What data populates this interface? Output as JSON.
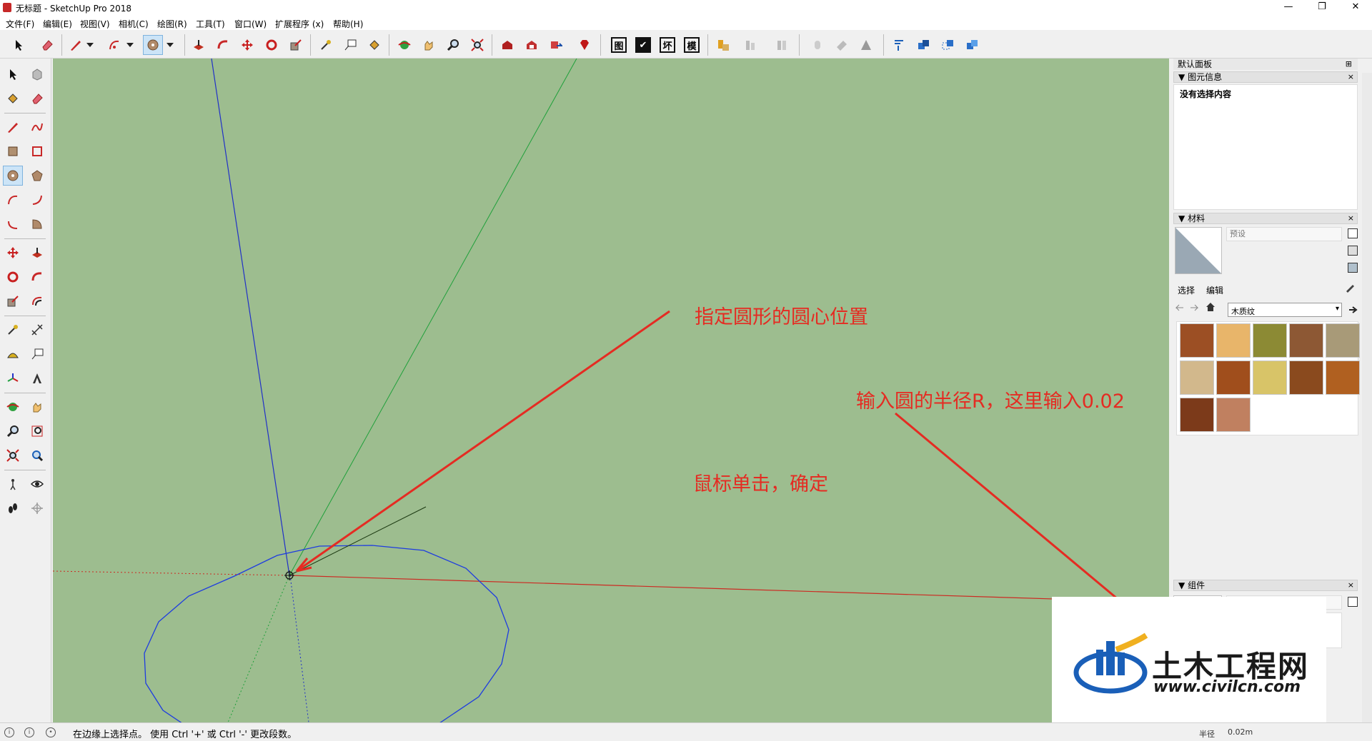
{
  "window": {
    "title": "无标题 - SketchUp Pro 2018",
    "minimize": "—",
    "maximize": "❐",
    "close": "✕"
  },
  "menu": {
    "items": [
      "文件(F)",
      "编辑(E)",
      "视图(V)",
      "相机(C)",
      "绘图(R)",
      "工具(T)",
      "窗口(W)",
      "扩展程序 (x)",
      "帮助(H)"
    ]
  },
  "toolbar": {
    "view_buttons": [
      "图",
      "✔",
      "坏",
      "模"
    ],
    "selected_tool": "circle-tool"
  },
  "annotations": {
    "center_note": "指定圆形的圆心位置",
    "radius_note": "输入圆的半径R，这里输入0.02",
    "click_note": "鼠标单击，确定"
  },
  "panel": {
    "title": "默认面板",
    "pin": "⊞",
    "entity_info": {
      "header": "图元信息",
      "empty_text": "没有选择内容"
    },
    "materials": {
      "header": "材料",
      "name_placeholder": "预设",
      "tab_select": "选择",
      "tab_edit": "编辑",
      "library": "木质纹",
      "swatch_colors": [
        "#9c4f24",
        "#e8b56a",
        "#8c8a34",
        "#8d5834",
        "#a89a78",
        "#d2b88c",
        "#a04e1c",
        "#d8c468",
        "#8a4a1e",
        "#b06020",
        "#7c3a1a",
        "#c08060"
      ]
    },
    "components": {
      "header": "组件"
    },
    "close_glyph": "×",
    "collapse_glyph": "▼"
  },
  "status": {
    "text": "在边缘上选择点。 使用 Ctrl '+' 或 Ctrl '-' 更改段数。",
    "measure_label": "半径",
    "measure_value": "0.02m"
  },
  "watermark": {
    "name": "土木工程网",
    "url": "www.civilcn.com"
  },
  "colors": {
    "viewport_bg": "#9dbd8f",
    "annotation": "#e52b22",
    "circle": "#1e3ce0",
    "axis_red": "#cc2a22",
    "axis_green": "#1ea03a",
    "axis_blue": "#2030c8"
  }
}
